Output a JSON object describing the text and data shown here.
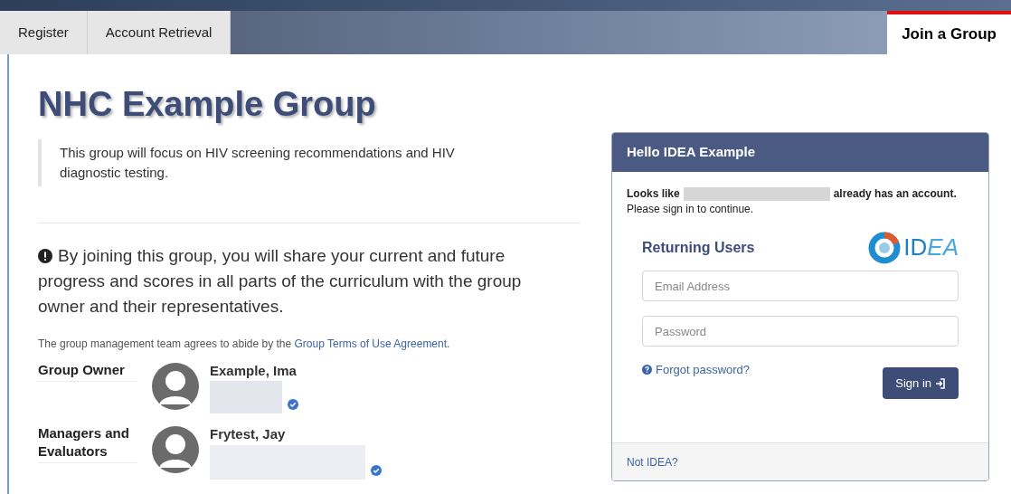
{
  "tabs": [
    {
      "label": "Register",
      "selected": false
    },
    {
      "label": "Account Retrieval",
      "selected": false
    },
    {
      "label": "Join a Group",
      "selected": true
    }
  ],
  "group": {
    "title": "NHC Example Group",
    "description": "This group will focus on HIV screening recommendations and HIV diagnostic testing.",
    "warning": "By joining this group, you will share your current and future progress and scores in all parts of the curriculum with the group owner and their representatives.",
    "terms_text": "The group management team agrees to abide by the",
    "terms_link": "Group Terms of Use Agreement",
    "terms_end": "."
  },
  "members": [
    {
      "role": "Group Owner",
      "name": "Example, Ima",
      "verified": true
    },
    {
      "role": "Managers and Evaluators",
      "name": "Frytest, Jay",
      "verified": true
    }
  ],
  "login_card": {
    "header": "Hello IDEA Example",
    "looks_like": "Looks like",
    "has_account": "already has an account.",
    "instruction": "Please sign in to continue.",
    "section_title": "Returning Users",
    "logo_main": "ID",
    "logo_accent": "EA",
    "email_placeholder": "Email Address",
    "password_placeholder": "Password",
    "forgot": "Forgot password?",
    "sign_in": "Sign in",
    "footer_link": "Not IDEA?"
  }
}
